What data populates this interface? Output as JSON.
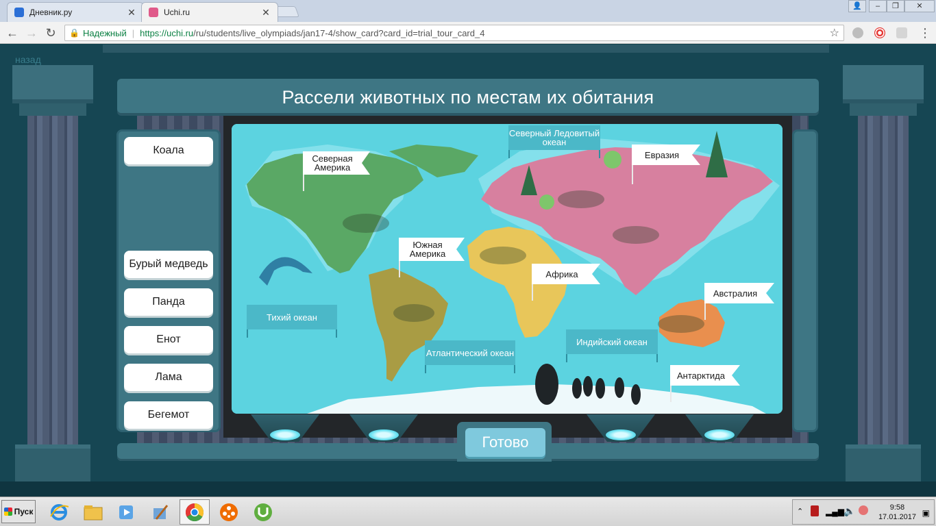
{
  "browser": {
    "tabs": [
      {
        "title": "Дневник.ру",
        "active": false
      },
      {
        "title": "Uchi.ru",
        "active": true
      }
    ],
    "security_label": "Надежный",
    "url_host": "https://uchi.ru",
    "url_path": "/ru/students/live_olympiads/jan17-4/show_card?card_id=trial_tour_card_4"
  },
  "page": {
    "back_link": "назад",
    "title": "Рассели животных по местам их обитания",
    "animal_cards": [
      "Коала",
      "Бурый медведь",
      "Панда",
      "Енот",
      "Лама",
      "Бегемот"
    ],
    "continents": {
      "north_america": "Северная Америка",
      "south_america": "Южная Америка",
      "eurasia": "Евразия",
      "africa": "Африка",
      "australia": "Австралия",
      "antarctica": "Антарктида"
    },
    "oceans": {
      "arctic": "Северный Ледовитый океан",
      "pacific": "Тихий океан",
      "atlantic": "Атлантический океан",
      "indian": "Индийский океан"
    },
    "ready_button": "Готово"
  },
  "colors": {
    "sea": "#5cd3e0",
    "north_america": "#5aa865",
    "south_america": "#a99c44",
    "eurasia": "#d7809f",
    "africa": "#e8c65a",
    "australia": "#e98f4e",
    "antarctica": "#eef9fb"
  },
  "taskbar": {
    "start_label": "Пуск",
    "time": "9:58",
    "date": "17.01.2017"
  }
}
